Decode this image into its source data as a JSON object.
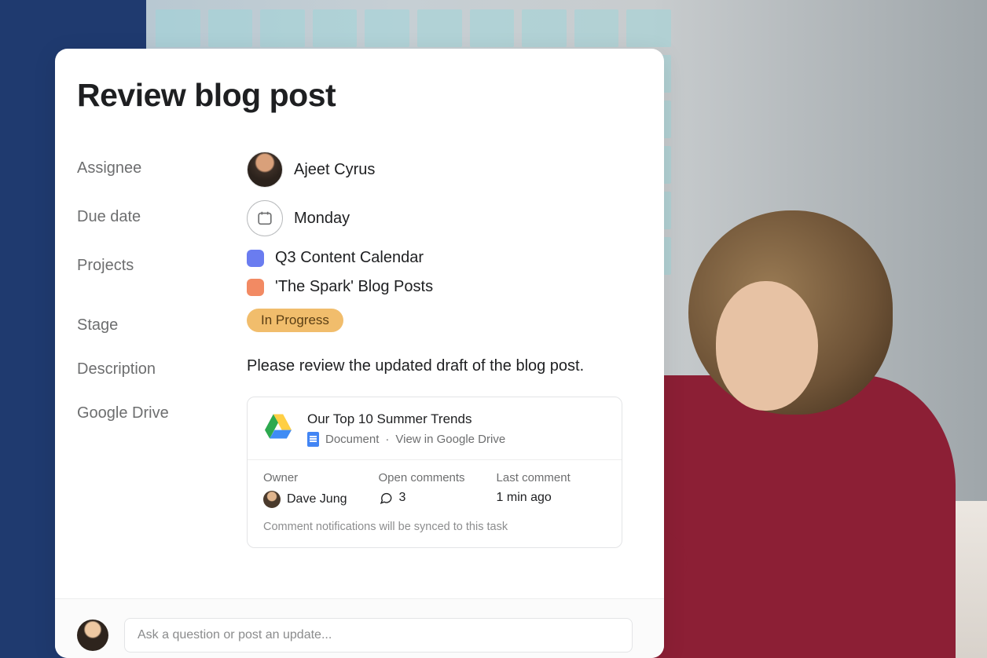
{
  "task": {
    "title": "Review blog post",
    "fields": {
      "assignee": {
        "label": "Assignee",
        "name": "Ajeet Cyrus"
      },
      "due_date": {
        "label": "Due date",
        "value": "Monday"
      },
      "projects": {
        "label": "Projects",
        "items": [
          {
            "name": "Q3 Content Calendar",
            "color": "#6a7cf0"
          },
          {
            "name": "'The Spark' Blog Posts",
            "color": "#f28a63"
          }
        ]
      },
      "stage": {
        "label": "Stage",
        "badge": "In Progress",
        "badge_color": "#f1bd6c"
      },
      "description": {
        "label": "Description",
        "text": "Please review the updated draft of the blog post."
      },
      "google_drive": {
        "label": "Google Drive",
        "attachment": {
          "title": "Our Top 10 Summer Trends",
          "type": "Document",
          "link_text": "View in Google Drive",
          "owner_label": "Owner",
          "owner_name": "Dave Jung",
          "comments_label": "Open comments",
          "comments_count": "3",
          "last_label": "Last comment",
          "last_value": "1 min ago",
          "sync_note": "Comment notifications will be synced to this task"
        }
      }
    }
  },
  "composer": {
    "placeholder": "Ask a question or post an update..."
  }
}
